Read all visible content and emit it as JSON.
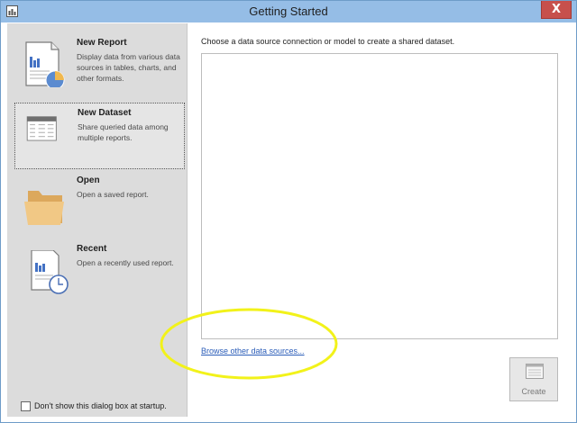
{
  "window": {
    "title": "Getting Started",
    "close_label": "X"
  },
  "sidebar": {
    "items": [
      {
        "title": "New Report",
        "description": "Display data from various data sources in tables, charts, and other formats.",
        "icon": "report-chart-icon"
      },
      {
        "title": "New Dataset",
        "description": "Share queried data among multiple reports.",
        "icon": "dataset-table-icon",
        "selected": true
      },
      {
        "title": "Open",
        "description": "Open a saved report.",
        "icon": "folder-icon"
      },
      {
        "title": "Recent",
        "description": "Open a recently used report.",
        "icon": "recent-report-clock-icon"
      }
    ],
    "startup_checkbox": {
      "label": "Don't show this dialog box at startup.",
      "checked": false
    }
  },
  "main": {
    "prompt": "Choose a data source connection or model to create a shared dataset.",
    "browse_link": "Browse other data sources...",
    "create_label": "Create"
  },
  "colors": {
    "titlebar": "#95bde6",
    "sidebar": "#dcdcdc",
    "close": "#c7504c",
    "link": "#2a5cb8",
    "highlight": "#f2f21a"
  }
}
